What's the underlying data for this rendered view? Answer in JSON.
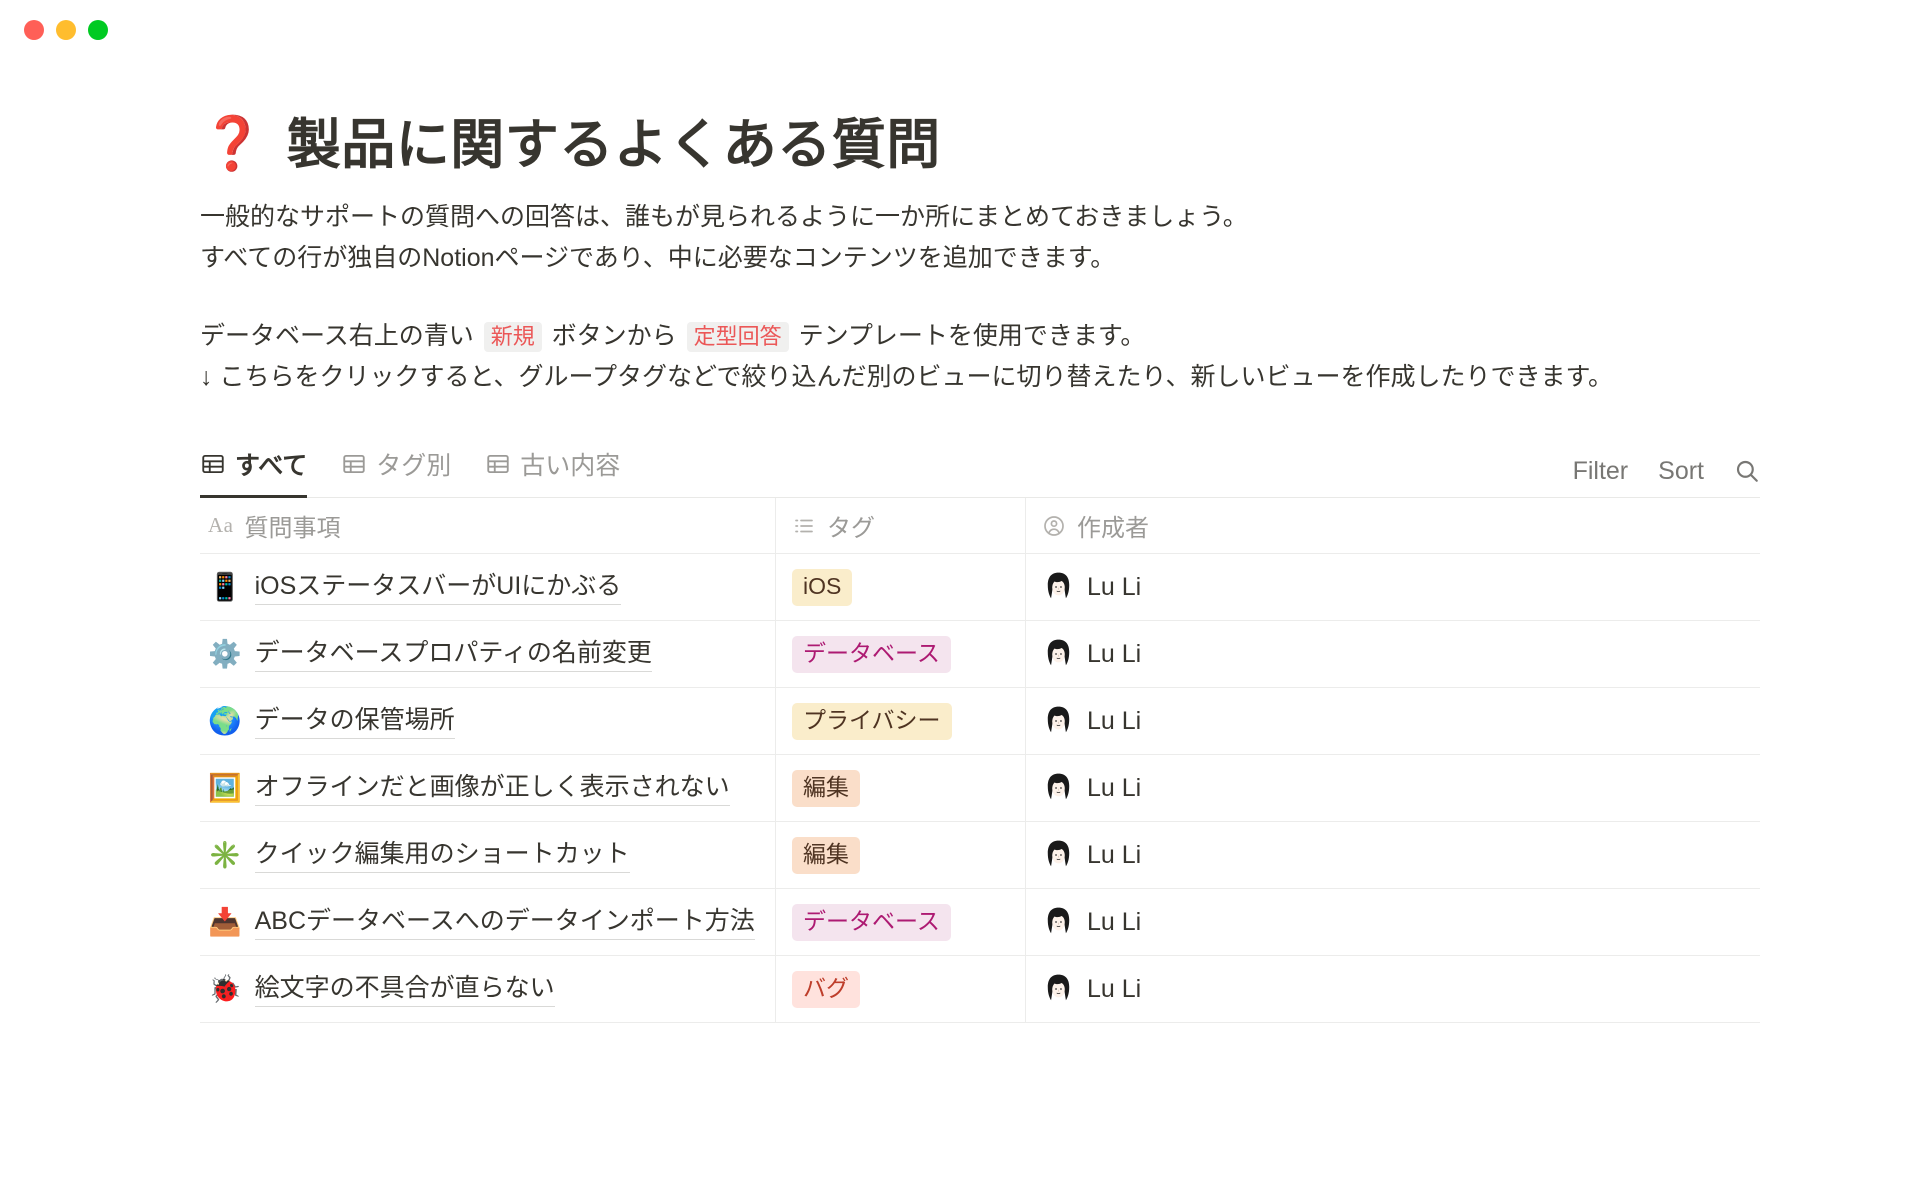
{
  "window": {
    "traffic_lights": [
      {
        "name": "close-button",
        "color": "#ff5f57"
      },
      {
        "name": "minimize-button",
        "color": "#ffbd2e"
      },
      {
        "name": "maximize-button",
        "color": "#00ca22"
      }
    ]
  },
  "page": {
    "title_emoji": "❓",
    "title": "製品に関するよくある質問",
    "paragraphs": [
      {
        "type": "plain",
        "text": "一般的なサポートの質問への回答は、誰もが見られるように一か所にまとめておきましょう。"
      },
      {
        "type": "plain",
        "text": "すべての行が独自のNotionページであり、中に必要なコンテンツを追加できます。"
      },
      {
        "type": "spacer"
      },
      {
        "type": "rich",
        "segments": [
          {
            "kind": "text",
            "text": "データベース右上の青い "
          },
          {
            "kind": "code",
            "text": "新規"
          },
          {
            "kind": "text",
            "text": " ボタンから "
          },
          {
            "kind": "code",
            "text": "定型回答"
          },
          {
            "kind": "text",
            "text": " テンプレートを使用できます。"
          }
        ]
      },
      {
        "type": "plain",
        "text": "↓ こちらをクリックすると、グループタグなどで絞り込んだ別のビューに切り替えたり、新しいビューを作成したりできます。"
      }
    ]
  },
  "database": {
    "views": [
      {
        "label": "すべて",
        "icon": "table-grid-icon",
        "active": true
      },
      {
        "label": "タグ別",
        "icon": "table-grid-icon",
        "active": false
      },
      {
        "label": "古い内容",
        "icon": "table-grid-icon",
        "active": false
      }
    ],
    "toolbar": {
      "filter_label": "Filter",
      "sort_label": "Sort",
      "search_icon": "search-icon"
    },
    "columns": [
      {
        "label": "質問事項",
        "icon": "text-property-icon",
        "icon_glyph": "Aa"
      },
      {
        "label": "タグ",
        "icon": "multi-select-property-icon"
      },
      {
        "label": "作成者",
        "icon": "person-property-icon"
      }
    ],
    "rows": [
      {
        "emoji": "📱",
        "emoji_name": "mobile-phone-emoji",
        "title": "iOSステータスバーがUIにかぶる",
        "tag": "iOS",
        "tag_bg": "#faedcb",
        "tag_fg": "#4f3422",
        "author": "Lu Li",
        "avatar": "woman-avatar"
      },
      {
        "emoji": "⚙️",
        "emoji_name": "gear-emoji",
        "title": "データベースプロパティの名前変更",
        "tag": "データベース",
        "tag_bg": "#f4e4ee",
        "tag_fg": "#ad1a72",
        "author": "Lu Li",
        "avatar": "woman-avatar"
      },
      {
        "emoji": "🌍",
        "emoji_name": "globe-emoji",
        "title": "データの保管場所",
        "tag": "プライバシー",
        "tag_bg": "#faedcb",
        "tag_fg": "#4f3422",
        "author": "Lu Li",
        "avatar": "woman-avatar"
      },
      {
        "emoji": "🖼️",
        "emoji_name": "framed-picture-emoji",
        "title": "オフラインだと画像が正しく表示されない",
        "tag": "編集",
        "tag_bg": "#fadec9",
        "tag_fg": "#4f3422",
        "author": "Lu Li",
        "avatar": "woman-avatar"
      },
      {
        "emoji": "✳️",
        "emoji_name": "eight-spoked-asterisk-emoji",
        "title": "クイック編集用のショートカット",
        "tag": "編集",
        "tag_bg": "#fadec9",
        "tag_fg": "#4f3422",
        "author": "Lu Li",
        "avatar": "woman-avatar"
      },
      {
        "emoji": "📥",
        "emoji_name": "inbox-tray-emoji",
        "title": "ABCデータベースへのデータインポート方法",
        "tag": "データベース",
        "tag_bg": "#f4e4ee",
        "tag_fg": "#ad1a72",
        "author": "Lu Li",
        "avatar": "woman-avatar"
      },
      {
        "emoji": "🐞",
        "emoji_name": "lady-beetle-emoji",
        "title": "絵文字の不具合が直らない",
        "tag": "バグ",
        "tag_bg": "#ffe2dd",
        "tag_fg": "#be3e2b",
        "author": "Lu Li",
        "avatar": "woman-avatar"
      }
    ]
  }
}
